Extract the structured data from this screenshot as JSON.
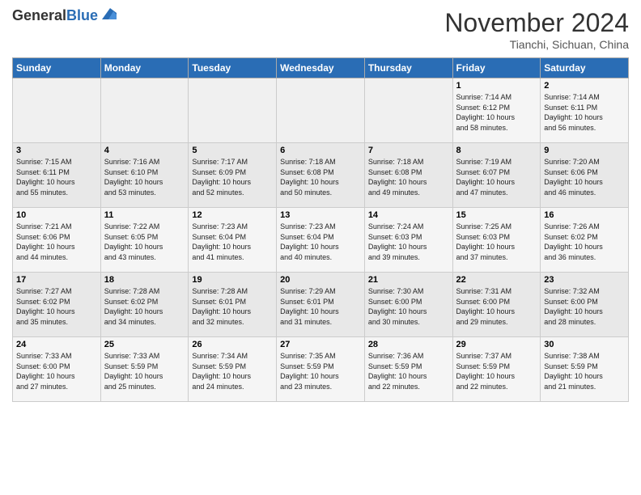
{
  "header": {
    "logo_general": "General",
    "logo_blue": "Blue",
    "month_title": "November 2024",
    "location": "Tianchi, Sichuan, China"
  },
  "weekdays": [
    "Sunday",
    "Monday",
    "Tuesday",
    "Wednesday",
    "Thursday",
    "Friday",
    "Saturday"
  ],
  "weeks": [
    [
      {
        "day": "",
        "info": ""
      },
      {
        "day": "",
        "info": ""
      },
      {
        "day": "",
        "info": ""
      },
      {
        "day": "",
        "info": ""
      },
      {
        "day": "",
        "info": ""
      },
      {
        "day": "1",
        "info": "Sunrise: 7:14 AM\nSunset: 6:12 PM\nDaylight: 10 hours\nand 58 minutes."
      },
      {
        "day": "2",
        "info": "Sunrise: 7:14 AM\nSunset: 6:11 PM\nDaylight: 10 hours\nand 56 minutes."
      }
    ],
    [
      {
        "day": "3",
        "info": "Sunrise: 7:15 AM\nSunset: 6:11 PM\nDaylight: 10 hours\nand 55 minutes."
      },
      {
        "day": "4",
        "info": "Sunrise: 7:16 AM\nSunset: 6:10 PM\nDaylight: 10 hours\nand 53 minutes."
      },
      {
        "day": "5",
        "info": "Sunrise: 7:17 AM\nSunset: 6:09 PM\nDaylight: 10 hours\nand 52 minutes."
      },
      {
        "day": "6",
        "info": "Sunrise: 7:18 AM\nSunset: 6:08 PM\nDaylight: 10 hours\nand 50 minutes."
      },
      {
        "day": "7",
        "info": "Sunrise: 7:18 AM\nSunset: 6:08 PM\nDaylight: 10 hours\nand 49 minutes."
      },
      {
        "day": "8",
        "info": "Sunrise: 7:19 AM\nSunset: 6:07 PM\nDaylight: 10 hours\nand 47 minutes."
      },
      {
        "day": "9",
        "info": "Sunrise: 7:20 AM\nSunset: 6:06 PM\nDaylight: 10 hours\nand 46 minutes."
      }
    ],
    [
      {
        "day": "10",
        "info": "Sunrise: 7:21 AM\nSunset: 6:06 PM\nDaylight: 10 hours\nand 44 minutes."
      },
      {
        "day": "11",
        "info": "Sunrise: 7:22 AM\nSunset: 6:05 PM\nDaylight: 10 hours\nand 43 minutes."
      },
      {
        "day": "12",
        "info": "Sunrise: 7:23 AM\nSunset: 6:04 PM\nDaylight: 10 hours\nand 41 minutes."
      },
      {
        "day": "13",
        "info": "Sunrise: 7:23 AM\nSunset: 6:04 PM\nDaylight: 10 hours\nand 40 minutes."
      },
      {
        "day": "14",
        "info": "Sunrise: 7:24 AM\nSunset: 6:03 PM\nDaylight: 10 hours\nand 39 minutes."
      },
      {
        "day": "15",
        "info": "Sunrise: 7:25 AM\nSunset: 6:03 PM\nDaylight: 10 hours\nand 37 minutes."
      },
      {
        "day": "16",
        "info": "Sunrise: 7:26 AM\nSunset: 6:02 PM\nDaylight: 10 hours\nand 36 minutes."
      }
    ],
    [
      {
        "day": "17",
        "info": "Sunrise: 7:27 AM\nSunset: 6:02 PM\nDaylight: 10 hours\nand 35 minutes."
      },
      {
        "day": "18",
        "info": "Sunrise: 7:28 AM\nSunset: 6:02 PM\nDaylight: 10 hours\nand 34 minutes."
      },
      {
        "day": "19",
        "info": "Sunrise: 7:28 AM\nSunset: 6:01 PM\nDaylight: 10 hours\nand 32 minutes."
      },
      {
        "day": "20",
        "info": "Sunrise: 7:29 AM\nSunset: 6:01 PM\nDaylight: 10 hours\nand 31 minutes."
      },
      {
        "day": "21",
        "info": "Sunrise: 7:30 AM\nSunset: 6:00 PM\nDaylight: 10 hours\nand 30 minutes."
      },
      {
        "day": "22",
        "info": "Sunrise: 7:31 AM\nSunset: 6:00 PM\nDaylight: 10 hours\nand 29 minutes."
      },
      {
        "day": "23",
        "info": "Sunrise: 7:32 AM\nSunset: 6:00 PM\nDaylight: 10 hours\nand 28 minutes."
      }
    ],
    [
      {
        "day": "24",
        "info": "Sunrise: 7:33 AM\nSunset: 6:00 PM\nDaylight: 10 hours\nand 27 minutes."
      },
      {
        "day": "25",
        "info": "Sunrise: 7:33 AM\nSunset: 5:59 PM\nDaylight: 10 hours\nand 25 minutes."
      },
      {
        "day": "26",
        "info": "Sunrise: 7:34 AM\nSunset: 5:59 PM\nDaylight: 10 hours\nand 24 minutes."
      },
      {
        "day": "27",
        "info": "Sunrise: 7:35 AM\nSunset: 5:59 PM\nDaylight: 10 hours\nand 23 minutes."
      },
      {
        "day": "28",
        "info": "Sunrise: 7:36 AM\nSunset: 5:59 PM\nDaylight: 10 hours\nand 22 minutes."
      },
      {
        "day": "29",
        "info": "Sunrise: 7:37 AM\nSunset: 5:59 PM\nDaylight: 10 hours\nand 22 minutes."
      },
      {
        "day": "30",
        "info": "Sunrise: 7:38 AM\nSunset: 5:59 PM\nDaylight: 10 hours\nand 21 minutes."
      }
    ]
  ]
}
